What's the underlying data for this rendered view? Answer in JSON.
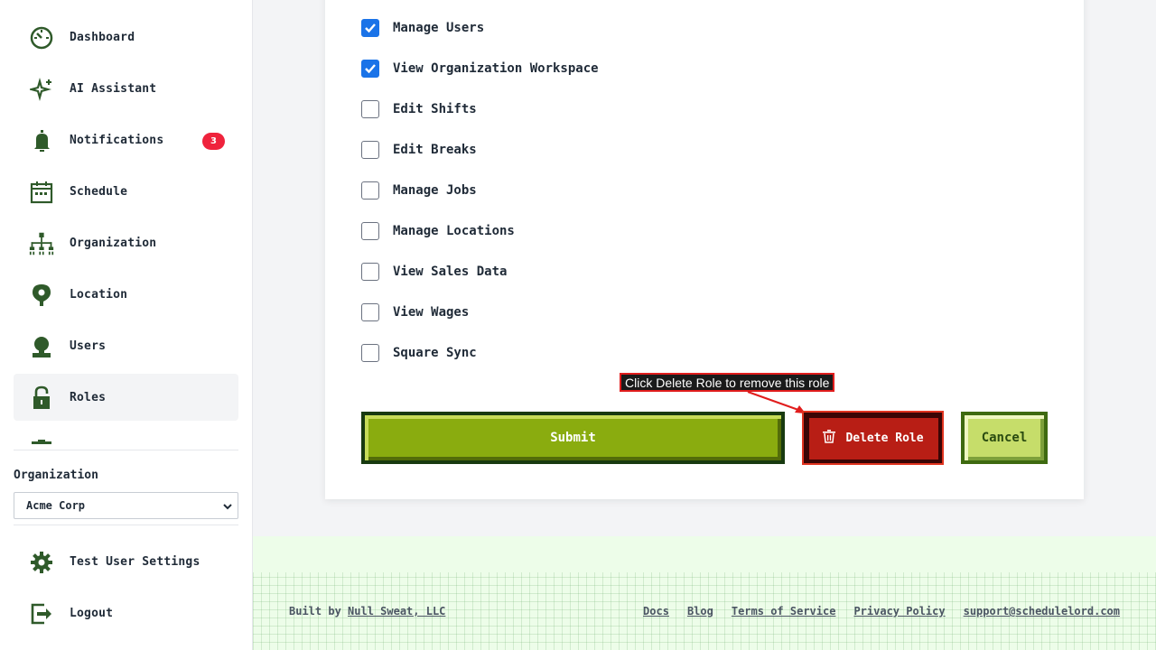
{
  "sidebar": {
    "items": [
      {
        "label": "Dashboard",
        "icon": "dashboard-gauge-icon"
      },
      {
        "label": "AI Assistant",
        "icon": "sparkle-icon"
      },
      {
        "label": "Notifications",
        "icon": "bell-icon",
        "badge": "3"
      },
      {
        "label": "Schedule",
        "icon": "calendar-icon"
      },
      {
        "label": "Organization",
        "icon": "org-chart-icon"
      },
      {
        "label": "Location",
        "icon": "map-pin-icon"
      },
      {
        "label": "Users",
        "icon": "user-icon"
      },
      {
        "label": "Roles",
        "icon": "lock-open-icon",
        "active": true
      }
    ],
    "organization_label": "Organization",
    "organization_value": "Acme Corp",
    "bottom_items": [
      {
        "label": "Test User Settings",
        "icon": "gear-icon"
      },
      {
        "label": "Logout",
        "icon": "logout-icon"
      }
    ]
  },
  "permissions": [
    {
      "label": "Manage Users",
      "checked": true
    },
    {
      "label": "View Organization Workspace",
      "checked": true
    },
    {
      "label": "Edit Shifts",
      "checked": false
    },
    {
      "label": "Edit Breaks",
      "checked": false
    },
    {
      "label": "Manage Jobs",
      "checked": false
    },
    {
      "label": "Manage Locations",
      "checked": false
    },
    {
      "label": "View Sales Data",
      "checked": false
    },
    {
      "label": "View Wages",
      "checked": false
    },
    {
      "label": "Square Sync",
      "checked": false
    }
  ],
  "buttons": {
    "submit": "Submit",
    "delete": "Delete Role",
    "cancel": "Cancel"
  },
  "tooltip": "Click Delete Role to remove this role",
  "footer": {
    "built_by_prefix": "Built by",
    "built_by_link": "Null Sweat, LLC",
    "links": [
      "Docs",
      "Blog",
      "Terms of Service",
      "Privacy Policy",
      "support@schedulelord.com"
    ]
  },
  "colors": {
    "brand_green": "#2f5a2a",
    "submit_green": "#8aac0f",
    "delete_red": "#b81e15",
    "cancel_lime": "#c6dd6a",
    "checkbox_blue": "#1a73e8",
    "badge_red": "#ef233c"
  }
}
